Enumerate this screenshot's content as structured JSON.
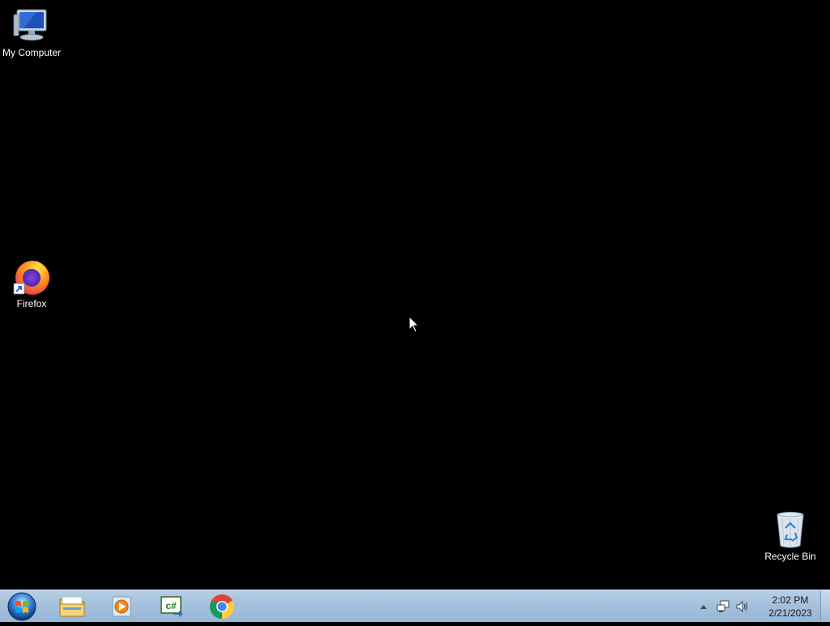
{
  "desktop": {
    "background_color": "#000000",
    "icons": [
      {
        "label": "My Computer",
        "icon": "computer-icon"
      },
      {
        "label": "Firefox",
        "icon": "firefox-icon",
        "shortcut": true
      },
      {
        "label": "Recycle Bin",
        "icon": "recycle-bin-icon"
      }
    ]
  },
  "taskbar": {
    "start_icon": "windows-orb-icon",
    "pinned": [
      {
        "name": "Windows Explorer",
        "icon": "folder-icon"
      },
      {
        "name": "Windows Media Player",
        "icon": "media-player-icon"
      },
      {
        "name": "C# IDE",
        "icon": "csharp-icon"
      },
      {
        "name": "Google Chrome",
        "icon": "chrome-icon"
      }
    ],
    "tray": {
      "icons": [
        "show-hidden-icons-arrow",
        "network-icon",
        "volume-icon"
      ],
      "time": "2:02 PM",
      "date": "2/21/2023"
    }
  }
}
